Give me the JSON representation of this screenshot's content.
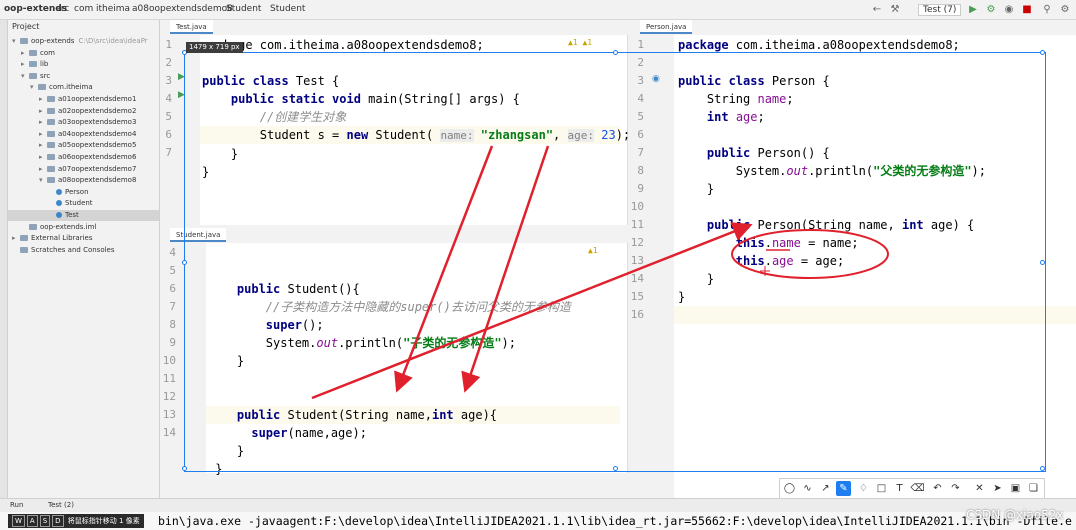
{
  "navbar": {
    "crumbs": [
      "oop-extends",
      "src",
      "com",
      "itheima",
      "a08oopextendsdemo8",
      "Student",
      "Student"
    ],
    "run_config": "Test (7)"
  },
  "project": {
    "header": "Project",
    "rows": [
      {
        "label": "oop-extends",
        "extra": "C:\\D\\src\\idea\\ideaPr",
        "indent": 0,
        "kind": "folder",
        "arrow": "v"
      },
      {
        "label": "com",
        "indent": 1,
        "kind": "folder",
        "arrow": ">"
      },
      {
        "label": "lib",
        "indent": 1,
        "kind": "folder",
        "arrow": ">"
      },
      {
        "label": "src",
        "indent": 1,
        "kind": "folder",
        "arrow": "v"
      },
      {
        "label": "com.itheima",
        "indent": 2,
        "kind": "folder",
        "arrow": "v"
      },
      {
        "label": "a01oopextendsdemo1",
        "indent": 3,
        "kind": "folder",
        "arrow": ">"
      },
      {
        "label": "a02oopextendsdemo2",
        "indent": 3,
        "kind": "folder",
        "arrow": ">"
      },
      {
        "label": "a03oopextendsdemo3",
        "indent": 3,
        "kind": "folder",
        "arrow": ">"
      },
      {
        "label": "a04oopextendsdemo4",
        "indent": 3,
        "kind": "folder",
        "arrow": ">"
      },
      {
        "label": "a05oopextendsdemo5",
        "indent": 3,
        "kind": "folder",
        "arrow": ">"
      },
      {
        "label": "a06oopextendsdemo6",
        "indent": 3,
        "kind": "folder",
        "arrow": ">"
      },
      {
        "label": "a07oopextendsdemo7",
        "indent": 3,
        "kind": "folder",
        "arrow": ">"
      },
      {
        "label": "a08oopextendsdemo8",
        "indent": 3,
        "kind": "folder",
        "arrow": "v"
      },
      {
        "label": "Person",
        "indent": 4,
        "kind": "class",
        "arrow": ""
      },
      {
        "label": "Student",
        "indent": 4,
        "kind": "class",
        "arrow": ""
      },
      {
        "label": "Test",
        "indent": 4,
        "kind": "class",
        "arrow": "",
        "selected": true
      },
      {
        "label": "oop-extends.iml",
        "indent": 1,
        "kind": "file",
        "arrow": ""
      },
      {
        "label": "External Libraries",
        "indent": 0,
        "kind": "folder",
        "arrow": ">"
      },
      {
        "label": "Scratches and Consoles",
        "indent": 0,
        "kind": "folder",
        "arrow": ""
      }
    ]
  },
  "tabs": {
    "test": "Test.java",
    "student": "Student.java",
    "person": "Person.java"
  },
  "overlay": {
    "size_badge": "1479 x 719 px"
  },
  "test_editor": {
    "warnings": "▲1 ▲1",
    "line_numbers": [
      "1",
      "2",
      "3",
      "4",
      "5",
      "6",
      "7"
    ],
    "pkg_line": "package com.itheima.a08oopextendsdemo8;"
  },
  "student_editor": {
    "warnings": "▲1",
    "line_numbers": [
      "4",
      "5",
      "6",
      "7",
      "8",
      "9",
      "10",
      "11",
      "12",
      "13",
      "14"
    ]
  },
  "person_editor": {
    "line_numbers": [
      "1",
      "2",
      "3",
      "4",
      "5",
      "6",
      "7",
      "8",
      "9",
      "10",
      "11",
      "12",
      "13",
      "14",
      "15",
      "16"
    ]
  },
  "bottom": {
    "run_tab": "Run",
    "test_tab": "Test (2)",
    "console_text": "bin\\java.exe -javaagent:F:\\develop\\idea\\IntelliJIDEA2021.1.1\\lib\\idea_rt.jar=55662:F:\\develop\\idea\\IntelliJIDEA2021.1.1\\bin -Dfile.e",
    "watermark": "CSDN @xiao52x",
    "wasd_keys": [
      "W",
      "A",
      "S",
      "D"
    ],
    "wasd_hint": "将鼠标指针移动 1 像素"
  },
  "colors": {
    "accent": "#1e7ef0",
    "annotation_red": "#e0212d",
    "swatches": [
      "#000000",
      "#7f7f7f",
      "#880015",
      "#ed1c24",
      "#ff7f27",
      "#fff200",
      "#22b14c",
      "#00a2e8",
      "#3f48cc",
      "#a349a4",
      "#ffffff",
      "#c3c3c3",
      "#b97a57",
      "#ffaec9",
      "#ffc90e",
      "#efe4b0",
      "#b5e61d",
      "#99d9ea",
      "#7092be",
      "#c8bfe7"
    ]
  }
}
